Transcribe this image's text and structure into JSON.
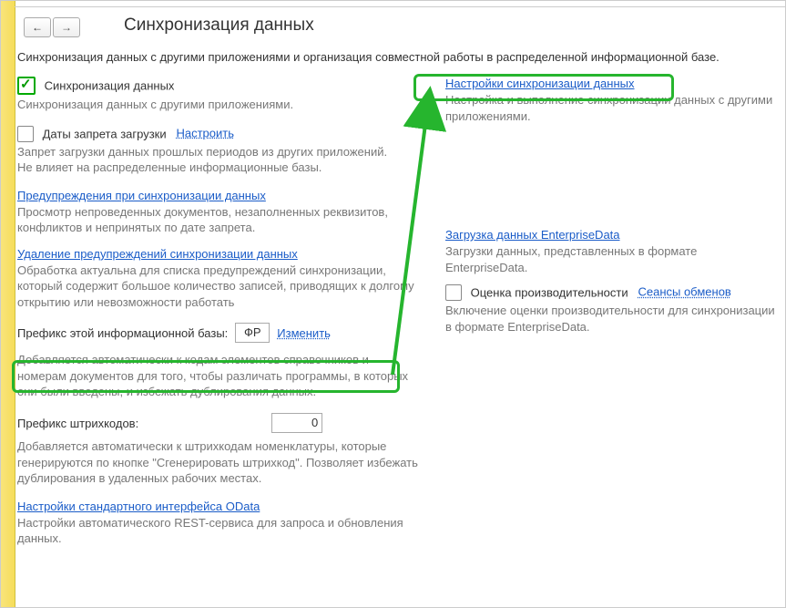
{
  "title": "Синхронизация данных",
  "intro": "Синхронизация данных с другими приложениями и организация совместной работы в распределенной информационной базе.",
  "left": {
    "syncChk": "Синхронизация данных",
    "syncDesc": "Синхронизация данных с другими приложениями.",
    "datesChk": "Даты запрета загрузки",
    "datesConfigure": "Настроить",
    "datesDesc": "Запрет загрузки данных прошлых периодов из других приложений.\nНе влияет на распределенные информационные базы.",
    "warnLink": "Предупреждения при синхронизации данных",
    "warnDesc": "Просмотр непроведенных документов, незаполненных реквизитов, конфликтов и непринятых по дате запрета.",
    "delLink": "Удаление предупреждений синхронизации данных",
    "delDesc": "Обработка актуальна для списка предупреждений синхронизации, который содержит большое количество записей, приводящих к долгому открытию или невозможности работать",
    "prefLabel": "Префикс этой информационной базы:",
    "prefVal": "ФР",
    "prefChange": "Изменить",
    "prefDesc": "Добавляется автоматически к кодам элементов справочников и номерам документов для того, чтобы различать программы, в которых они были введены, и избежать дублирования данных.",
    "bcLabel": "Префикс штрихкодов:",
    "bcVal": "0",
    "bcDesc": "Добавляется автоматически к штрихкодам номенклатуры, которые генерируются по кнопке \"Сгенерировать штрихкод\". Позволяет избежать дублирования в удаленных рабочих местах.",
    "odataLink": "Настройки стандартного интерфейса OData",
    "odataDesc": "Настройки автоматического REST-сервиса для запроса и обновления данных."
  },
  "right": {
    "settingsLink": "Настройки синхронизации данных",
    "settingsDesc": "Настройка и выполнение синхронизации данных с другими приложениями.",
    "loadLink": "Загрузка данных EnterpriseData",
    "loadDesc": "Загрузки данных, представленных в формате EnterpriseData.",
    "perfChk": "Оценка производительности",
    "perfLink": "Сеансы обменов",
    "perfDesc": "Включение оценки производительности для синхронизации в формате EnterpriseData."
  }
}
